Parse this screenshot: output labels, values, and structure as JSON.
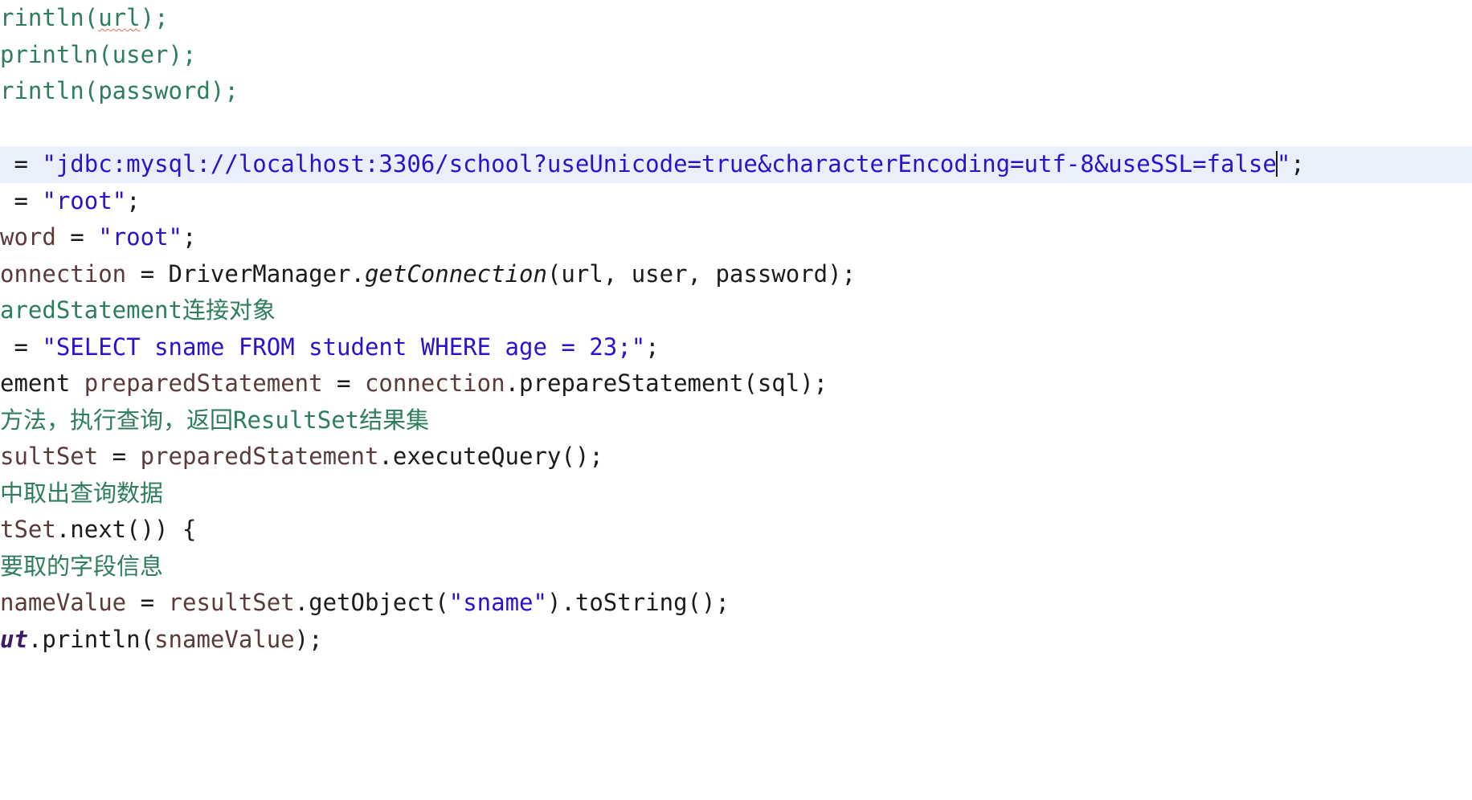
{
  "editor": {
    "language": "java",
    "background_color": "#ffffff",
    "current_line_highlight_color": "#e9f0fb",
    "comment_color": "#2e7d5b",
    "string_color": "#2a12cf",
    "identifier_color": "#5a3a3a",
    "keyword_color": "#1b1b1b",
    "spellcheck_underline_color": "#e06c5f",
    "caret_color": "#1b1b1b",
    "horizontally_scrolled": true
  },
  "lines": [
    {
      "id": "line-println-url",
      "highlight": false,
      "tokens": [
        {
          "kind": "comment",
          "text": "rintln("
        },
        {
          "kind": "comment-misspelled",
          "text": "url"
        },
        {
          "kind": "comment",
          "text": ");"
        }
      ]
    },
    {
      "id": "line-println-user",
      "highlight": false,
      "tokens": [
        {
          "kind": "comment",
          "text": "println(user);"
        }
      ]
    },
    {
      "id": "line-println-password",
      "highlight": false,
      "tokens": [
        {
          "kind": "comment",
          "text": "rintln(password);"
        }
      ]
    },
    {
      "id": "line-blank-1",
      "highlight": false,
      "tokens": []
    },
    {
      "id": "line-url-assignment",
      "highlight": true,
      "tokens": [
        {
          "kind": "plain",
          "text": " = "
        },
        {
          "kind": "string",
          "text": "\"jdbc:mysql://localhost:3306/school?useUnicode=true&characterEncoding=utf-8&useSSL=false"
        },
        {
          "kind": "caret",
          "text": ""
        },
        {
          "kind": "string",
          "text": "\""
        },
        {
          "kind": "plain",
          "text": ";"
        }
      ]
    },
    {
      "id": "line-user-assignment",
      "highlight": false,
      "tokens": [
        {
          "kind": "plain",
          "text": " = "
        },
        {
          "kind": "string",
          "text": "\"root\""
        },
        {
          "kind": "plain",
          "text": ";"
        }
      ]
    },
    {
      "id": "line-password-assignment",
      "highlight": false,
      "tokens": [
        {
          "kind": "ident",
          "text": "word"
        },
        {
          "kind": "plain",
          "text": " = "
        },
        {
          "kind": "string",
          "text": "\"root\""
        },
        {
          "kind": "plain",
          "text": ";"
        }
      ]
    },
    {
      "id": "line-get-connection",
      "highlight": false,
      "tokens": [
        {
          "kind": "ident",
          "text": "onnection"
        },
        {
          "kind": "plain",
          "text": " = DriverManager."
        },
        {
          "kind": "static",
          "text": "getConnection"
        },
        {
          "kind": "plain",
          "text": "(url, user, password);"
        }
      ]
    },
    {
      "id": "line-comment-prepared-statement",
      "highlight": false,
      "tokens": [
        {
          "kind": "comment",
          "text": "aredStatement连接对象"
        }
      ]
    },
    {
      "id": "line-sql-assignment",
      "highlight": false,
      "tokens": [
        {
          "kind": "plain",
          "text": " = "
        },
        {
          "kind": "string",
          "text": "\"SELECT sname FROM student WHERE age = 23;\""
        },
        {
          "kind": "plain",
          "text": ";"
        }
      ]
    },
    {
      "id": "line-prepare-statement",
      "highlight": false,
      "tokens": [
        {
          "kind": "plain",
          "text": "ement "
        },
        {
          "kind": "ident",
          "text": "preparedStatement"
        },
        {
          "kind": "plain",
          "text": " = "
        },
        {
          "kind": "ident",
          "text": "connection"
        },
        {
          "kind": "plain",
          "text": ".prepareStatement(sql);"
        }
      ]
    },
    {
      "id": "line-comment-execute-query",
      "highlight": false,
      "tokens": [
        {
          "kind": "comment",
          "text": "方法，执行查询，返回ResultSet结果集"
        }
      ]
    },
    {
      "id": "line-execute-query",
      "highlight": false,
      "tokens": [
        {
          "kind": "ident",
          "text": "sultSet"
        },
        {
          "kind": "plain",
          "text": " = "
        },
        {
          "kind": "ident",
          "text": "preparedStatement"
        },
        {
          "kind": "plain",
          "text": ".executeQuery();"
        }
      ]
    },
    {
      "id": "line-comment-fetch-data",
      "highlight": false,
      "tokens": [
        {
          "kind": "comment",
          "text": "中取出查询数据"
        }
      ]
    },
    {
      "id": "line-while-next",
      "highlight": false,
      "tokens": [
        {
          "kind": "ident",
          "text": "tSet"
        },
        {
          "kind": "plain",
          "text": ".next()) {"
        }
      ]
    },
    {
      "id": "line-comment-field-info",
      "highlight": false,
      "tokens": [
        {
          "kind": "comment",
          "text": "要取的字段信息"
        }
      ]
    },
    {
      "id": "line-sname-value",
      "highlight": false,
      "tokens": [
        {
          "kind": "ident",
          "text": "nameValue"
        },
        {
          "kind": "plain",
          "text": " = "
        },
        {
          "kind": "ident",
          "text": "resultSet"
        },
        {
          "kind": "plain",
          "text": ".getObject("
        },
        {
          "kind": "string",
          "text": "\"sname\""
        },
        {
          "kind": "plain",
          "text": ").toString();"
        }
      ]
    },
    {
      "id": "line-print-sname",
      "highlight": false,
      "tokens": [
        {
          "kind": "staticfield",
          "text": "ut"
        },
        {
          "kind": "plain",
          "text": ".println("
        },
        {
          "kind": "ident",
          "text": "snameValue"
        },
        {
          "kind": "plain",
          "text": ");"
        }
      ]
    }
  ]
}
